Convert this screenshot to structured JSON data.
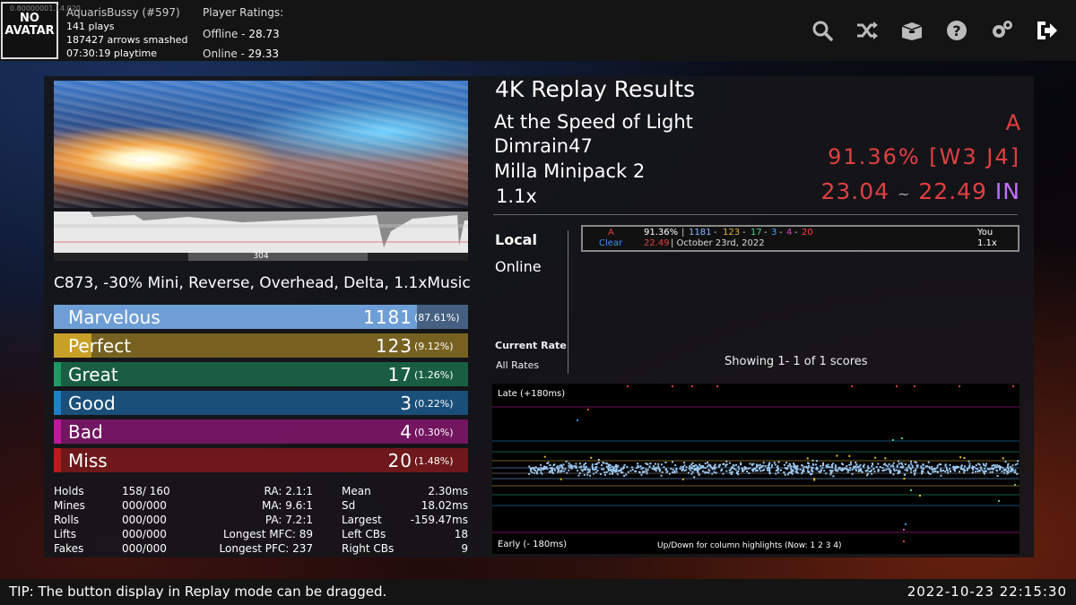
{
  "profile": {
    "avatar_text": "NO AVATAR",
    "tiny_id": "0.80000001.14.020",
    "name": "AquarisBussy (#597)",
    "plays": "141 plays",
    "arrows": "187427 arrows smashed",
    "playtime": "07:30:19 playtime"
  },
  "ratings": {
    "header": "Player Ratings:",
    "offline_label": "Offline - ",
    "offline": "28.73",
    "online_label": "Online - ",
    "online": "29.33"
  },
  "toolbar_icons": [
    "search-icon",
    "shuffle-icon",
    "box-icon",
    "help-icon",
    "settings-icon",
    "exit-icon"
  ],
  "results": {
    "title": "4K Replay Results",
    "song": "At the Speed of Light",
    "artist": "Dimrain47",
    "pack": "Milla Minipack 2",
    "rate": "1.1x",
    "grade": "A",
    "percent": "91.36% [W3 J4]",
    "msd": "23.04",
    "tilde": "~",
    "ssr": "22.49",
    "ssr_suffix": "IN"
  },
  "lifebar_label": "304",
  "modline": "C873, -30% Mini, Reverse, Overhead, Delta, 1.1xMusic",
  "judgments": [
    {
      "name": "Marvelous",
      "count": "1181",
      "pct": "(87.61%)",
      "fraction": 0.8761,
      "color": "#6e9ed6"
    },
    {
      "name": "Perfect",
      "count": "123",
      "pct": "(9.12%)",
      "fraction": 0.0912,
      "color": "#c8a028"
    },
    {
      "name": "Great",
      "count": "17",
      "pct": "(1.26%)",
      "fraction": 0.0126,
      "color": "#1e9a64"
    },
    {
      "name": "Good",
      "count": "3",
      "pct": "(0.22%)",
      "fraction": 0.0022,
      "color": "#1e80c8"
    },
    {
      "name": "Bad",
      "count": "4",
      "pct": "(0.30%)",
      "fraction": 0.003,
      "color": "#c0189c"
    },
    {
      "name": "Miss",
      "count": "20",
      "pct": "(1.48%)",
      "fraction": 0.0148,
      "color": "#b81c1c"
    }
  ],
  "stats_left": [
    {
      "label": "Holds",
      "value": "158/ 160"
    },
    {
      "label": "Mines",
      "value": "000/000"
    },
    {
      "label": "Rolls",
      "value": "000/000"
    },
    {
      "label": "Lifts",
      "value": "000/000"
    },
    {
      "label": "Fakes",
      "value": "000/000"
    }
  ],
  "stats_mid": [
    "RA: 2.1:1",
    "MA: 9.6:1",
    "PA: 7.2:1",
    "Longest MFC: 89",
    "Longest PFC: 237"
  ],
  "stats_right": [
    {
      "label": "Mean",
      "value": "2.30ms"
    },
    {
      "label": "Sd",
      "value": "18.02ms"
    },
    {
      "label": "Largest",
      "value": "-159.47ms"
    },
    {
      "label": "Left CBs",
      "value": "18"
    },
    {
      "label": "Right CBs",
      "value": "9"
    }
  ],
  "scoreboard": {
    "tab_local": "Local",
    "tab_online": "Online",
    "current_rate": "Current Rate",
    "all_rates": "All Rates",
    "showing": "Showing  1- 1  of  1  scores",
    "entry": {
      "grade": "A",
      "status": "Clear",
      "percent": "91.36%",
      "marv": "1181",
      "perf": "123",
      "great": "17",
      "good": "3",
      "bad": "4",
      "miss": "20",
      "ssr": "22.49",
      "date": "| October 23rd, 2022",
      "player": "You",
      "rate": "1.1x"
    }
  },
  "offset_plot": {
    "late_label": "Late (+180ms)",
    "early_label": "Early (- 180ms)",
    "hint": "Up/Down for column highlights (Now:  1 2 3 4)"
  },
  "tip": "TIP: The button display in Replay mode can be dragged.",
  "clock": "2022-10-23 22:15:30"
}
